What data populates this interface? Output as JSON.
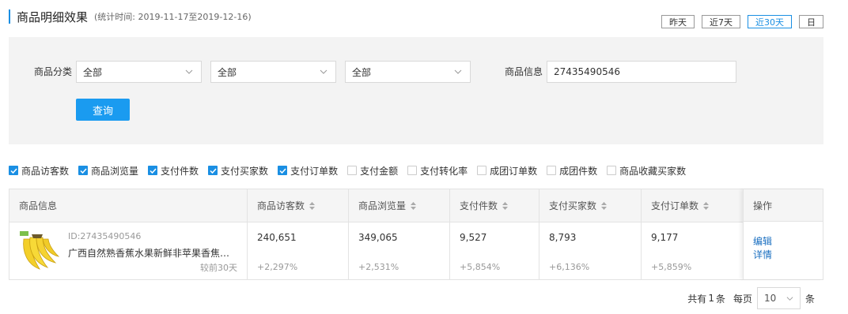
{
  "header": {
    "title": "商品明细效果",
    "subtitle": "(统计时间: 2019-11-17至2019-12-16)",
    "range_buttons": [
      "昨天",
      "近7天",
      "近30天",
      "日"
    ],
    "active_range": "近30天"
  },
  "filters": {
    "category_label": "商品分类",
    "category_selects": [
      "全部",
      "全部",
      "全部"
    ],
    "info_label": "商品信息",
    "info_value": "27435490546",
    "query_button": "查询"
  },
  "metrics": [
    {
      "label": "商品访客数",
      "checked": true
    },
    {
      "label": "商品浏览量",
      "checked": true
    },
    {
      "label": "支付件数",
      "checked": true
    },
    {
      "label": "支付买家数",
      "checked": true
    },
    {
      "label": "支付订单数",
      "checked": true
    },
    {
      "label": "支付金额",
      "checked": false
    },
    {
      "label": "支付转化率",
      "checked": false
    },
    {
      "label": "成团订单数",
      "checked": false
    },
    {
      "label": "成团件数",
      "checked": false
    },
    {
      "label": "商品收藏买家数",
      "checked": false
    }
  ],
  "table": {
    "columns": [
      "商品信息",
      "商品访客数",
      "商品浏览量",
      "支付件数",
      "支付买家数",
      "支付订单数",
      "操作"
    ],
    "rows": [
      {
        "product_id": "ID:27435490546",
        "product_name": "广西自然熟香蕉水果新鲜非苹果香焦小米蕉",
        "compare_label": "较前30天",
        "values": [
          "240,651",
          "349,065",
          "9,527",
          "8,793",
          "9,177"
        ],
        "deltas": [
          "+2,297%",
          "+2,531%",
          "+5,854%",
          "+6,136%",
          "+5,859%"
        ],
        "actions": [
          "编辑",
          "详情"
        ]
      }
    ]
  },
  "pagination": {
    "total_prefix": "共有",
    "total": "1",
    "total_suffix": "条",
    "per_page_label": "每页",
    "page_size": "10",
    "page_size_suffix": "条"
  },
  "colors": {
    "accent": "#1a8fe3",
    "primary_button": "#1a9bf0",
    "link": "#1a6fc0",
    "panel_bg": "#f3f3f3",
    "header_bg": "#f5f5f5"
  }
}
